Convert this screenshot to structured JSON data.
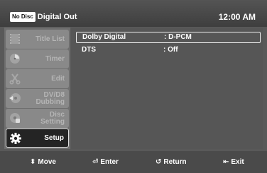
{
  "header": {
    "badge": "No Disc",
    "title": "Digital Out",
    "time": "12:00 AM"
  },
  "menu": [
    {
      "label": "Title List",
      "icon": "film-icon",
      "selected": false
    },
    {
      "label": "Timer",
      "icon": "clock-icon",
      "selected": false
    },
    {
      "label": "Edit",
      "icon": "scissors-icon",
      "selected": false
    },
    {
      "label": "DV/D8\nDubbing",
      "icon": "dubbing-icon",
      "selected": false
    },
    {
      "label": "Disc\nSetting",
      "icon": "disc-icon",
      "selected": false
    },
    {
      "label": "Setup",
      "icon": "gear-icon",
      "selected": true
    }
  ],
  "settings": [
    {
      "name": "Dolby Digital",
      "value": ": D-PCM",
      "selected": true
    },
    {
      "name": "DTS",
      "value": ": Off",
      "selected": false
    }
  ],
  "footer": {
    "move_icon": "⬍",
    "move": "Move",
    "enter_icon": "⏎",
    "enter": "Enter",
    "return_icon": "↺",
    "return": "Return",
    "exit_icon": "⇤",
    "exit": "Exit"
  },
  "colors": {
    "background": "#595959",
    "menu": "#6e6e6e",
    "selected_item": "#242424"
  }
}
